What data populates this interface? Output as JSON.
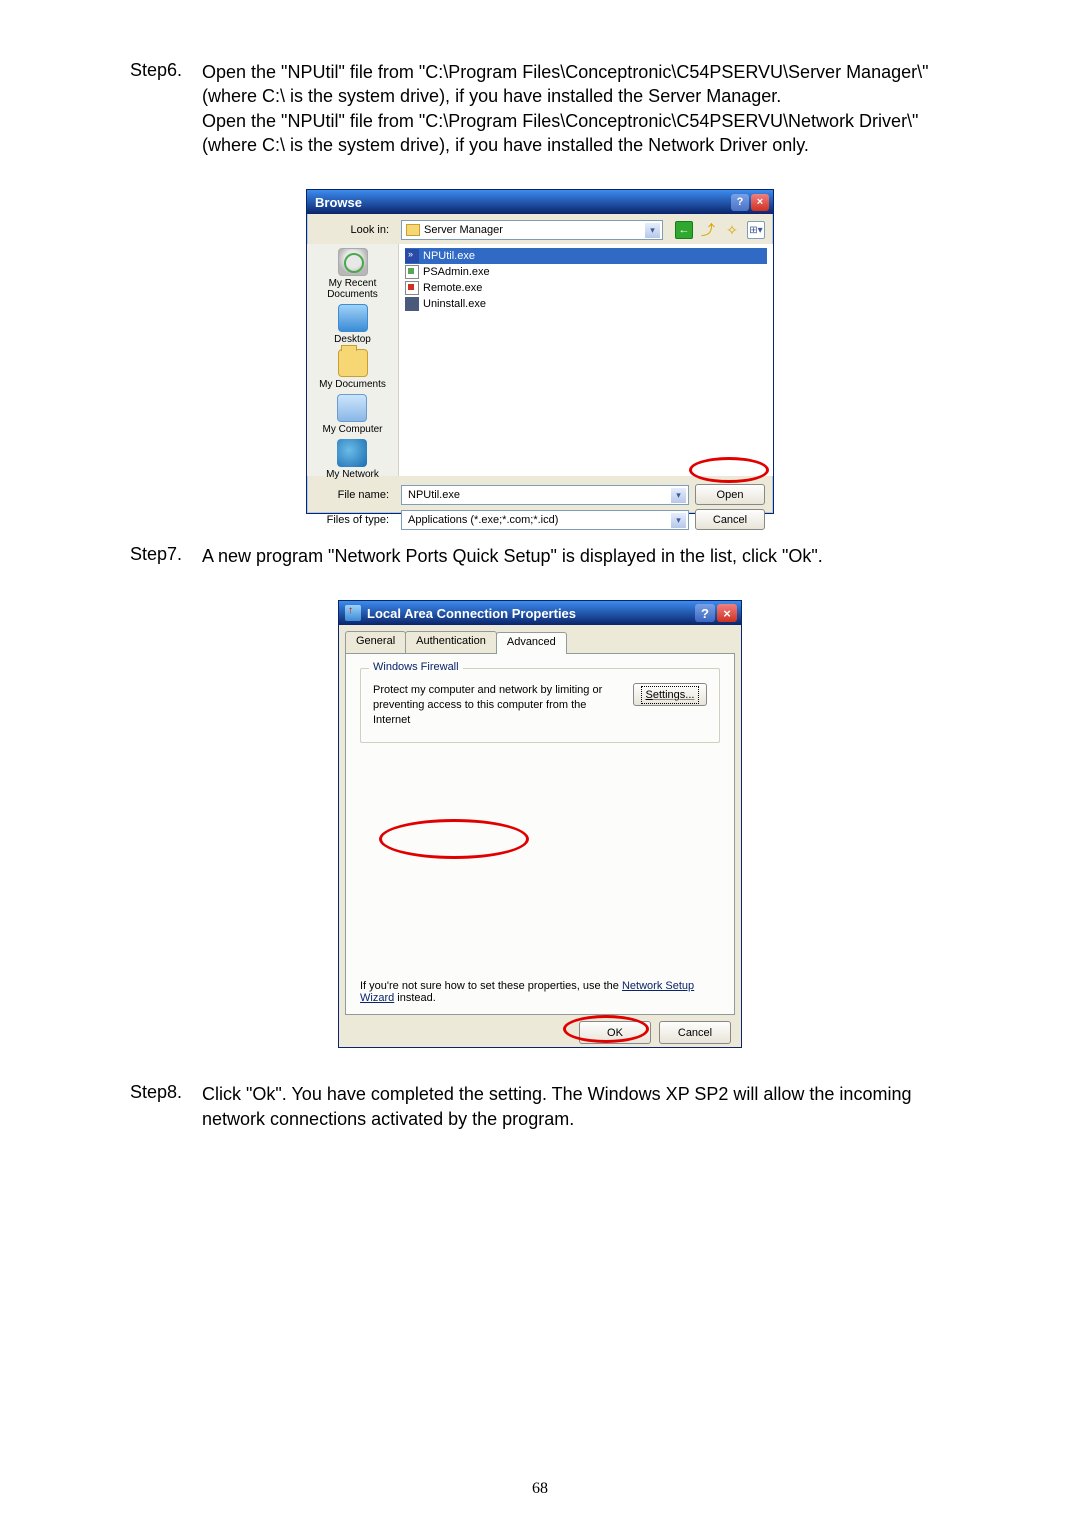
{
  "steps": {
    "s6_label": "Step6.",
    "s6_body_1": "Open the \"NPUtil\" file from \"C:\\Program Files\\Conceptronic\\C54PSERVU\\Server Manager\\\" (where C:\\ is the system drive), if you have installed the Server Manager.",
    "s6_body_2": "Open the \"NPUtil\" file from \"C:\\Program Files\\Conceptronic\\C54PSERVU\\Network Driver\\\" (where C:\\ is the system drive), if you have installed the Network Driver only.",
    "s7_label": "Step7.",
    "s7_body": "A new program \"Network Ports Quick Setup\" is displayed in the list, click \"Ok\".",
    "s8_label": "Step8.",
    "s8_body": "Click \"Ok\". You have completed the setting. The Windows XP SP2 will allow the incoming network connections activated by the program."
  },
  "browse": {
    "title": "Browse",
    "lookin_label": "Look in:",
    "lookin_value": "Server Manager",
    "places": {
      "recent": "My Recent Documents",
      "desktop": "Desktop",
      "mydocs": "My Documents",
      "mycomp": "My Computer",
      "mynet": "My Network"
    },
    "files": {
      "f0": "NPUtil.exe",
      "f1": "PSAdmin.exe",
      "f2": "Remote.exe",
      "f3": "Uninstall.exe"
    },
    "filename_label": "File name:",
    "filename_value": "NPUtil.exe",
    "filetype_label": "Files of type:",
    "filetype_value": "Applications (*.exe;*.com;*.icd)",
    "open_btn": "Open",
    "cancel_btn": "Cancel"
  },
  "lac": {
    "title": "Local Area Connection Properties",
    "tabs": {
      "general": "General",
      "auth": "Authentication",
      "adv": "Advanced"
    },
    "group_title": "Windows Firewall",
    "protect_text": "Protect my computer and network by limiting or preventing access to this computer from the Internet",
    "settings_btn": "Settings...",
    "note_prefix": "If you're not sure how to set these properties, use the ",
    "note_link": "Network Setup Wizard",
    "note_suffix": " instead.",
    "ok_btn": "OK",
    "cancel_btn": "Cancel"
  },
  "pagenum": "68"
}
